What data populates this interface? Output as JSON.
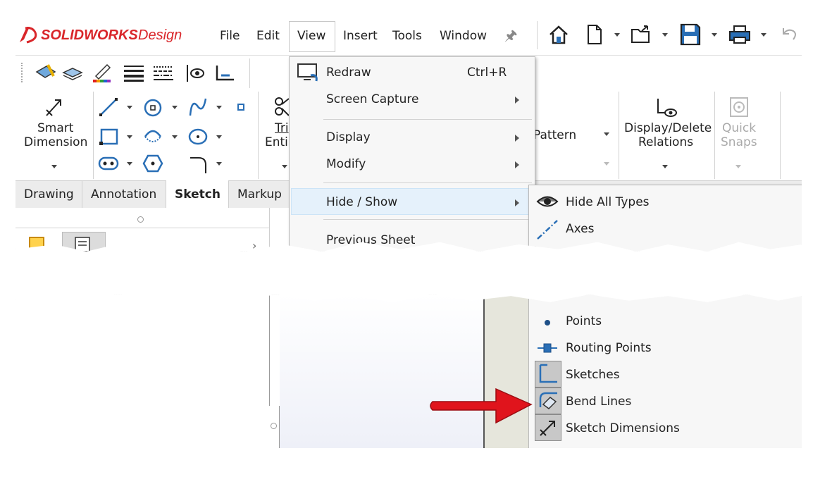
{
  "app": {
    "brand": "SOLIDWORKS",
    "product": "Design"
  },
  "menubar": {
    "items": [
      "File",
      "Edit",
      "View",
      "Insert",
      "Tools",
      "Window"
    ]
  },
  "ribbon": {
    "smart_dimension": [
      "Smart",
      "Dimension"
    ],
    "trim_partial": [
      "Tri",
      "Enti"
    ],
    "pattern_partial": "Pattern",
    "display_delete_relations": [
      "Display/Delete",
      "Relations"
    ],
    "quick_snaps": [
      "Quick",
      "Snaps"
    ]
  },
  "tabs": [
    "Drawing",
    "Annotation",
    "Sketch",
    "Markup"
  ],
  "view_menu": {
    "items": [
      {
        "label": "Redraw",
        "shortcut": "Ctrl+R"
      },
      {
        "label": "Screen Capture"
      },
      {
        "label": "Display"
      },
      {
        "label": "Modify"
      },
      {
        "label": "Hide / Show"
      },
      {
        "label": "Previous Sheet"
      }
    ]
  },
  "hide_show_submenu": {
    "items_top": [
      "Hide All Types",
      "Axes"
    ],
    "items_bottom": [
      "Points",
      "Routing Points",
      "Sketches",
      "Bend Lines",
      "Sketch Dimensions"
    ]
  },
  "colors": {
    "brand_red": "#d9262a",
    "arrow_red": "#e0141c",
    "menu_hover": "#e5f1fb",
    "hover_border": "#cce4f7"
  }
}
